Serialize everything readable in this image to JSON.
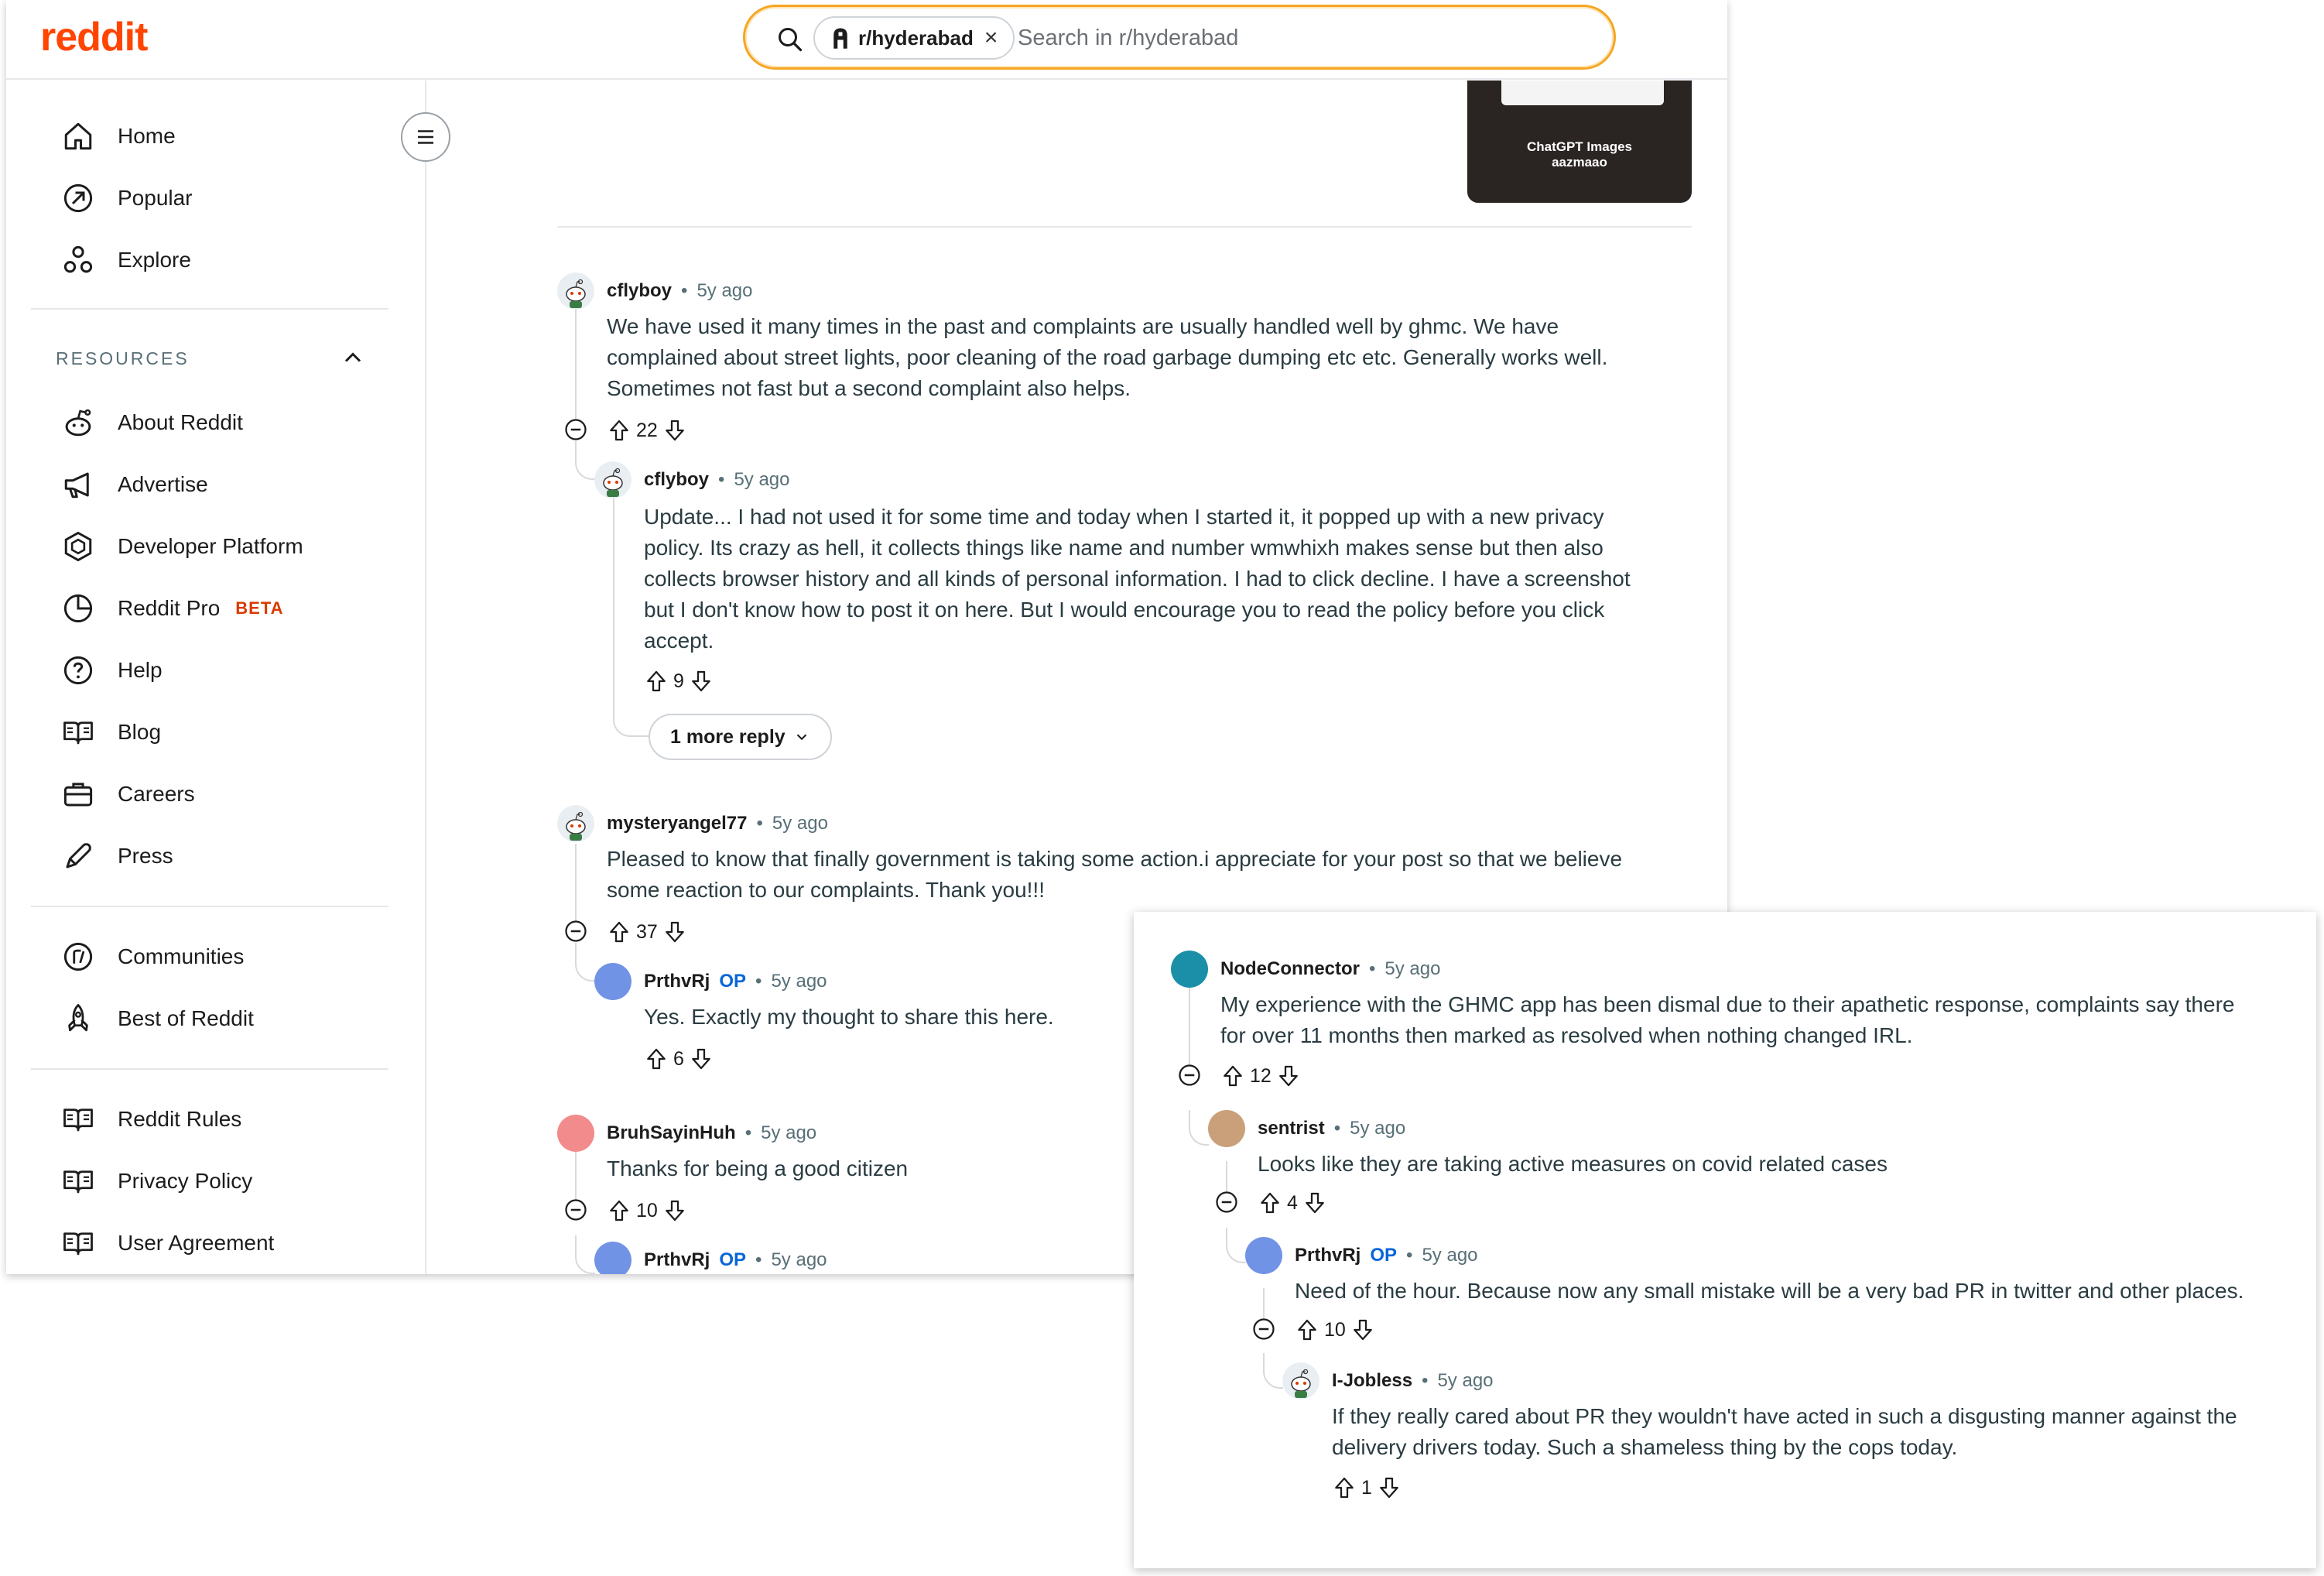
{
  "app": {
    "logo": "reddit"
  },
  "search": {
    "chip": "r/hyderabad",
    "chip_close": "×",
    "placeholder": "Search in r/hyderabad"
  },
  "sidebar": {
    "main": [
      {
        "label": "Home",
        "icon": "home-icon"
      },
      {
        "label": "Popular",
        "icon": "popular-icon"
      },
      {
        "label": "Explore",
        "icon": "explore-icon"
      }
    ],
    "resources_heading": "RESOURCES",
    "resources": [
      {
        "label": "About Reddit",
        "icon": "reddit-alien-icon"
      },
      {
        "label": "Advertise",
        "icon": "megaphone-icon"
      },
      {
        "label": "Developer Platform",
        "icon": "hexagon-icon"
      },
      {
        "label": "Reddit Pro",
        "icon": "pie-chart-icon",
        "badge": "BETA"
      },
      {
        "label": "Help",
        "icon": "help-icon"
      },
      {
        "label": "Blog",
        "icon": "book-icon"
      },
      {
        "label": "Careers",
        "icon": "briefcase-icon"
      },
      {
        "label": "Press",
        "icon": "pen-icon"
      }
    ],
    "communities": [
      {
        "label": "Communities",
        "icon": "communities-icon"
      },
      {
        "label": "Best of Reddit",
        "icon": "rocket-icon"
      }
    ],
    "legal": [
      {
        "label": "Reddit Rules",
        "icon": "book-icon"
      },
      {
        "label": "Privacy Policy",
        "icon": "book-icon"
      },
      {
        "label": "User Agreement",
        "icon": "book-icon"
      }
    ]
  },
  "thumbnail": {
    "line1": "ChatGPT Images",
    "line2": "aazmaao"
  },
  "comments_main": [
    {
      "author": "cflyboy",
      "op": "",
      "age": "5y ago",
      "body": [
        "We have used it many times in the past and complaints are usually handled well by ghmc. We have",
        "complained about street lights, poor cleaning of the road garbage dumping etc etc. Generally works well.",
        "Sometimes not fast but a second complaint also helps."
      ],
      "votes": "22"
    },
    {
      "author": "cflyboy",
      "op": "",
      "age": "5y ago",
      "body": [
        "Update... I had not used it for some time and today when I started it, it popped up with a new privacy",
        "policy. Its crazy as hell, it collects things like name and number wmwhixh makes sense but then also",
        "collects browser history and all kinds of personal information. I had to click decline. I have a screenshot",
        "but I don't know how to post it on here. But I would encourage you to read the policy before you click",
        "accept."
      ],
      "votes": "9"
    },
    {
      "author": "mysteryangel77",
      "op": "",
      "age": "5y ago",
      "body": [
        "Pleased to know that finally government is taking some action.i appreciate for your post so that we believe",
        "some reaction to our complaints. Thank you!!!"
      ],
      "votes": "37"
    },
    {
      "author": "PrthvRj",
      "op": "OP",
      "age": "5y ago",
      "body": [
        "Yes. Exactly my thought to share this here."
      ],
      "votes": "6"
    },
    {
      "author": "BruhSayinHuh",
      "op": "",
      "age": "5y ago",
      "body": [
        "Thanks for being a good citizen"
      ],
      "votes": "10"
    },
    {
      "author": "PrthvRj",
      "op": "OP",
      "age": "5y ago",
      "body": [],
      "votes": ""
    }
  ],
  "more_replies": "1 more reply",
  "comments_overlay": [
    {
      "author": "NodeConnector",
      "op": "",
      "age": "5y ago",
      "body": [
        "My experience with the GHMC app has been dismal due to their apathetic response, complaints say there",
        "for over 11 months then marked as resolved when nothing changed IRL."
      ],
      "votes": "12"
    },
    {
      "author": "sentrist",
      "op": "",
      "age": "5y ago",
      "body": [
        "Looks like they are taking active measures on covid related cases"
      ],
      "votes": "4"
    },
    {
      "author": "PrthvRj",
      "op": "OP",
      "age": "5y ago",
      "body": [
        "Need of the hour. Because now any small mistake will be a very bad PR in twitter and other places."
      ],
      "votes": "10"
    },
    {
      "author": "I-Jobless",
      "op": "",
      "age": "5y ago",
      "body": [
        "If they really cared about PR they wouldn't have acted in such a disgusting manner against the",
        "delivery drivers today. Such a shameless thing by the cops today."
      ],
      "votes": "1"
    }
  ],
  "meta_sep": "•",
  "colors": {
    "brand": "#ff4500",
    "op": "#0a66d8",
    "beta": "#d93a00",
    "search_border": "#f5a623"
  }
}
